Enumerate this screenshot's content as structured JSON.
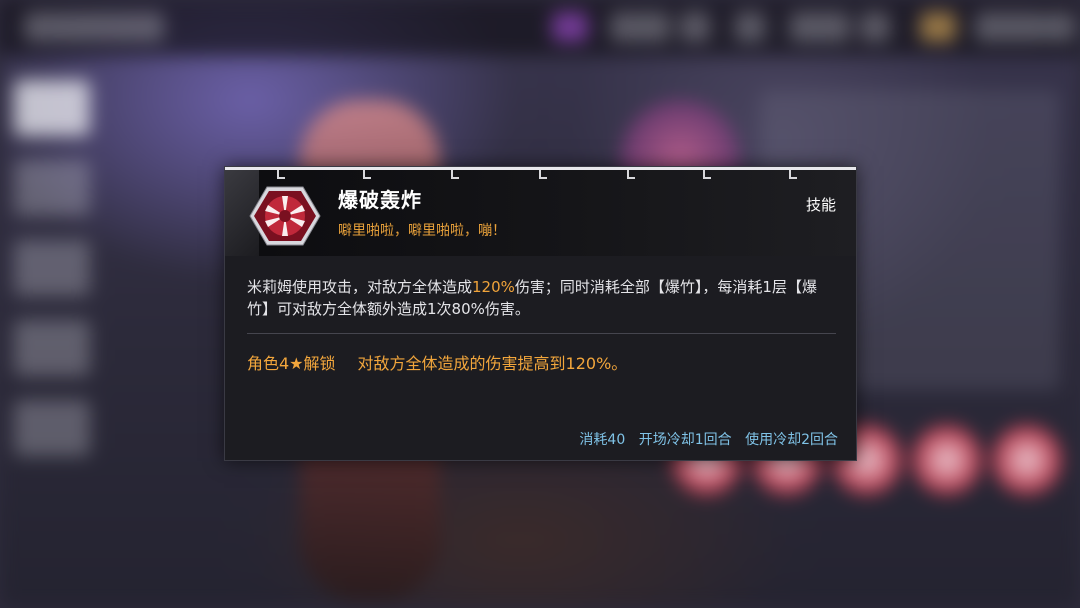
{
  "colors": {
    "accent_orange": "#f0a33a",
    "footer_blue": "#7fc2e6",
    "tooltip_bg": "#1c1c21",
    "icon_red": "#c0283a"
  },
  "skill": {
    "icon": "explosion-hexagon-icon",
    "name": "爆破轰炸",
    "quote": "噼里啪啦，噼里啪啦，嘣！",
    "type_label": "技能",
    "description": {
      "part1": "米莉姆使用攻击，对敌方全体造成",
      "highlight": "120%",
      "part2": "伤害；同时消耗全部【爆竹】，每消耗1层【爆竹】可对敌方全体额外造成1次80%伤害。"
    },
    "unlock": {
      "condition": "角色4★解锁",
      "effect": "对敌方全体造成的伤害提高到120%。"
    },
    "stats": {
      "cost": "消耗40",
      "opening_cooldown": "开场冷却1回合",
      "use_cooldown": "使用冷却2回合"
    }
  }
}
